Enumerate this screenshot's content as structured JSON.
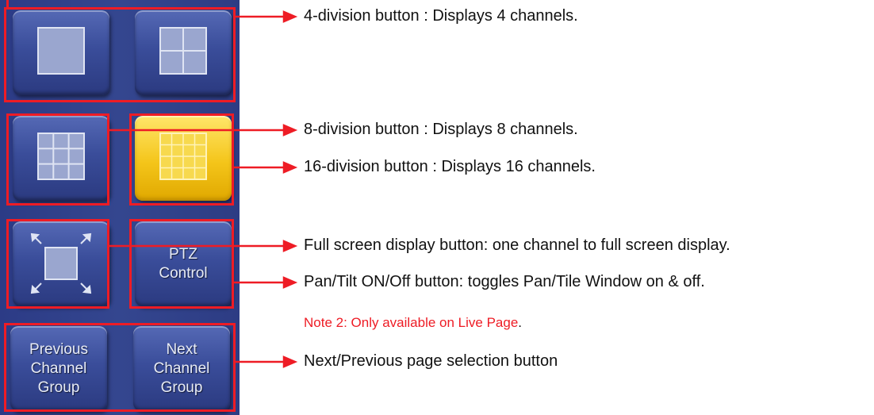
{
  "buttons": {
    "single_view": {
      "icon": "single-square-icon"
    },
    "quad_view": {
      "icon": "quad-grid-icon"
    },
    "nine_view": {
      "icon": "nine-grid-icon"
    },
    "sixteen_view": {
      "icon": "sixteen-grid-icon",
      "state": "active"
    },
    "full_screen": {
      "icon": "fullscreen-arrows-icon"
    },
    "ptz": {
      "label_line1": "PTZ",
      "label_line2": "Control"
    },
    "previous_group": {
      "label_line1": "Previous",
      "label_line2": "Channel",
      "label_line3": "Group"
    },
    "next_group": {
      "label_line1": "Next",
      "label_line2": "Channel",
      "label_line3": "Group"
    }
  },
  "annotations": {
    "four_division": "4-division button : Displays 4 channels.",
    "eight_division": "8-division button : Displays 8 channels.",
    "sixteen_division": "16-division button : Displays 16 channels.",
    "full_screen": "Full screen display button: one channel to full screen display.",
    "pan_tilt": "Pan/Tilt ON/Off button: toggles Pan/Tile Window on & off.",
    "note2_prefix": "Note 2: Only available on Live Page",
    "note2_suffix": ".",
    "page_select": "Next/Previous page selection button"
  },
  "colors": {
    "panel": "#34468f",
    "button": "#3a4d9a",
    "active_button": "#f4c51a",
    "highlight": "#ee1c25",
    "note_text": "#ee1c25"
  }
}
